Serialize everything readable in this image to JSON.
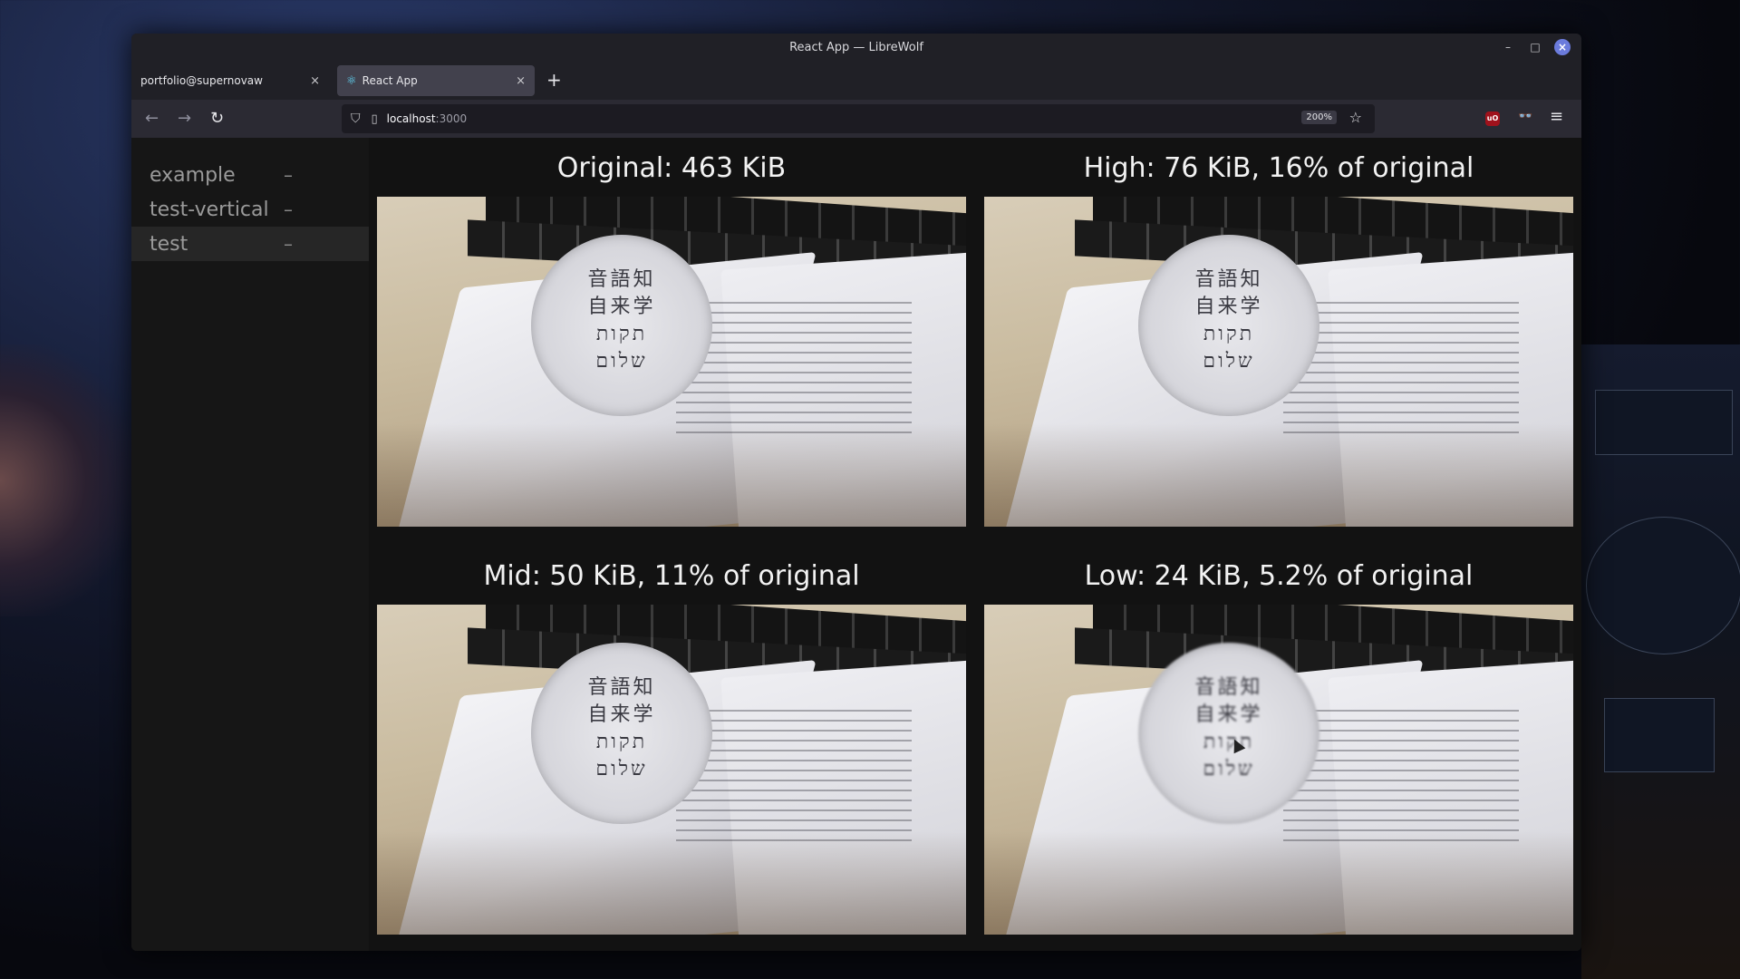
{
  "window": {
    "title": "React App — LibreWolf"
  },
  "tabs": [
    {
      "label": "portfolio@supernovaw"
    },
    {
      "label": "React App"
    }
  ],
  "address": {
    "host": "localhost",
    "port": ":3000",
    "zoom": "200%"
  },
  "extensions": {
    "ublock": "uO"
  },
  "sidebar": {
    "items": [
      {
        "label": "example",
        "toggle": "–",
        "active": false
      },
      {
        "label": "test-vertical",
        "toggle": "–",
        "active": false
      },
      {
        "label": "test",
        "toggle": "–",
        "active": true
      }
    ]
  },
  "comparisons": [
    {
      "title": "Original: 463 KiB"
    },
    {
      "title": "High: 76 KiB, 16% of original"
    },
    {
      "title": "Mid: 50 KiB, 11% of original"
    },
    {
      "title": "Low: 24 KiB, 5.2% of original"
    }
  ],
  "icons": {
    "back": "←",
    "forward": "→",
    "reload": "↻",
    "shield": "⛉",
    "page": "▯",
    "star": "☆",
    "menu": "≡",
    "close": "×",
    "plus": "+",
    "minimize": "–",
    "maximize": "□",
    "react": "⚛",
    "glasses": "👓"
  },
  "colors": {
    "accent": "#6b7bdc",
    "react": "#61dafb"
  }
}
